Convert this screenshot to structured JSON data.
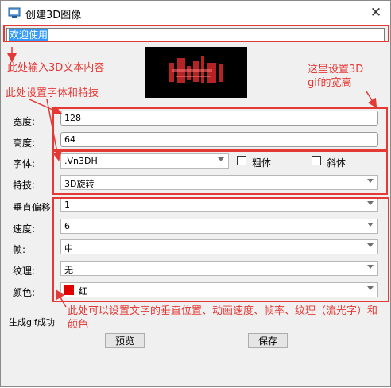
{
  "window": {
    "title": "创建3D图像"
  },
  "text_input": {
    "value": "欢迎使用"
  },
  "fields": {
    "width": {
      "label": "宽度:",
      "value": "128"
    },
    "height": {
      "label": "高度:",
      "value": "64"
    },
    "font": {
      "label": "字体:",
      "value": ".Vn3DH",
      "bold_label": "粗体",
      "italic_label": "斜体"
    },
    "effect": {
      "label": "特技:",
      "value": "3D旋转"
    },
    "v_offset": {
      "label": "垂直偏移:",
      "value": "1"
    },
    "speed": {
      "label": "速度:",
      "value": "6"
    },
    "frame": {
      "label": "帧:",
      "value": "中"
    },
    "texture": {
      "label": "纹理:",
      "value": "无"
    },
    "color": {
      "label": "颜色:",
      "value": "红",
      "swatch": "#e00000"
    }
  },
  "status_text": "生成gif成功",
  "buttons": {
    "preview": "预览",
    "save": "保存"
  },
  "annotations": {
    "input_note": "此处输入3D文本内容",
    "font_note": "此处设置字体和特技",
    "size_note": "这里设置3D gif的宽高",
    "anim_note": "此处可以设置文字的垂直位置、动画速度、帧率、纹理（流光字）和颜色",
    "accent": "#e53935"
  }
}
